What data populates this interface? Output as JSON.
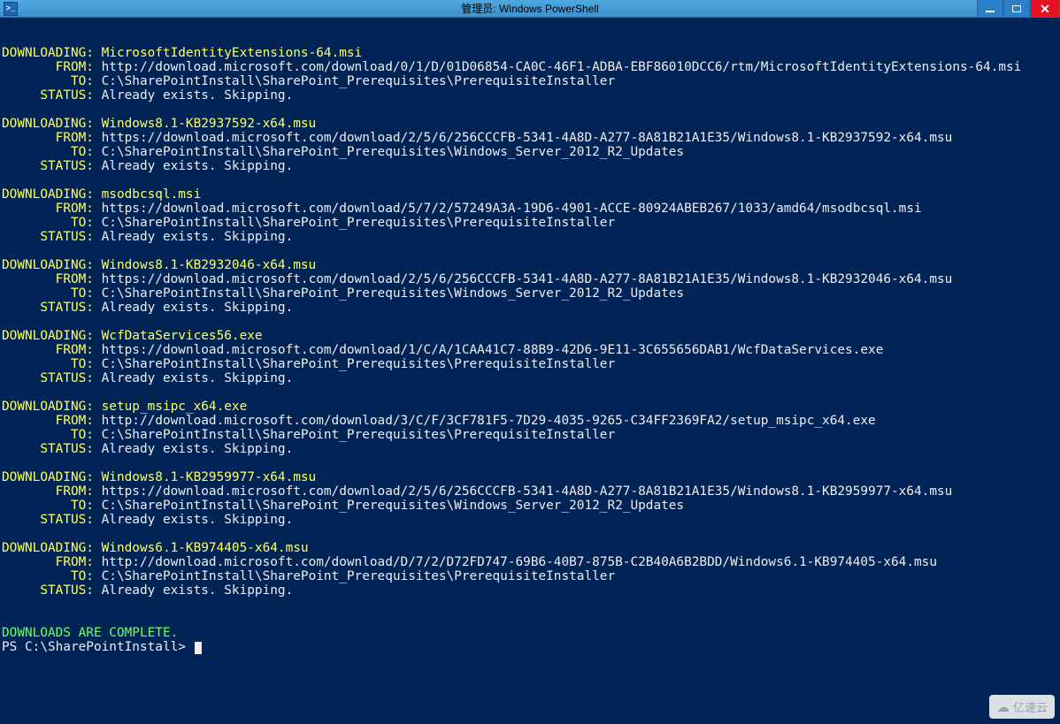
{
  "window": {
    "title": "管理员: Windows PowerShell",
    "icon_text": ">_"
  },
  "labels": {
    "DOWNLOADING": "DOWNLOADING:",
    "FROM": "       FROM: ",
    "TO": "         TO: ",
    "STATUS": "     STATUS: "
  },
  "status_text": "Already exists. Skipping.",
  "complete_text": "DOWNLOADS ARE COMPLETE.",
  "prompt": "PS C:\\SharePointInstall> ",
  "entries": [
    {
      "file": "MicrosoftIdentityExtensions-64.msi",
      "from": "http://download.microsoft.com/download/0/1/D/01D06854-CA0C-46F1-ADBA-EBF86010DCC6/rtm/MicrosoftIdentityExtensions-64.msi",
      "to": "C:\\SharePointInstall\\SharePoint_Prerequisites\\PrerequisiteInstaller"
    },
    {
      "file": "Windows8.1-KB2937592-x64.msu",
      "from": "https://download.microsoft.com/download/2/5/6/256CCCFB-5341-4A8D-A277-8A81B21A1E35/Windows8.1-KB2937592-x64.msu",
      "to": "C:\\SharePointInstall\\SharePoint_Prerequisites\\Windows_Server_2012_R2_Updates"
    },
    {
      "file": "msodbcsql.msi",
      "from": "https://download.microsoft.com/download/5/7/2/57249A3A-19D6-4901-ACCE-80924ABEB267/1033/amd64/msodbcsql.msi",
      "to": "C:\\SharePointInstall\\SharePoint_Prerequisites\\PrerequisiteInstaller"
    },
    {
      "file": "Windows8.1-KB2932046-x64.msu",
      "from": "https://download.microsoft.com/download/2/5/6/256CCCFB-5341-4A8D-A277-8A81B21A1E35/Windows8.1-KB2932046-x64.msu",
      "to": "C:\\SharePointInstall\\SharePoint_Prerequisites\\Windows_Server_2012_R2_Updates"
    },
    {
      "file": "WcfDataServices56.exe",
      "from": "https://download.microsoft.com/download/1/C/A/1CAA41C7-88B9-42D6-9E11-3C655656DAB1/WcfDataServices.exe",
      "to": "C:\\SharePointInstall\\SharePoint_Prerequisites\\PrerequisiteInstaller"
    },
    {
      "file": "setup_msipc_x64.exe",
      "from": "http://download.microsoft.com/download/3/C/F/3CF781F5-7D29-4035-9265-C34FF2369FA2/setup_msipc_x64.exe",
      "to": "C:\\SharePointInstall\\SharePoint_Prerequisites\\PrerequisiteInstaller"
    },
    {
      "file": "Windows8.1-KB2959977-x64.msu",
      "from": "https://download.microsoft.com/download/2/5/6/256CCCFB-5341-4A8D-A277-8A81B21A1E35/Windows8.1-KB2959977-x64.msu",
      "to": "C:\\SharePointInstall\\SharePoint_Prerequisites\\Windows_Server_2012_R2_Updates"
    },
    {
      "file": "Windows6.1-KB974405-x64.msu",
      "from": "http://download.microsoft.com/download/D/7/2/D72FD747-69B6-40B7-875B-C2B40A6B2BDD/Windows6.1-KB974405-x64.msu",
      "to": "C:\\SharePointInstall\\SharePoint_Prerequisites\\PrerequisiteInstaller"
    }
  ],
  "watermark": "亿速云"
}
